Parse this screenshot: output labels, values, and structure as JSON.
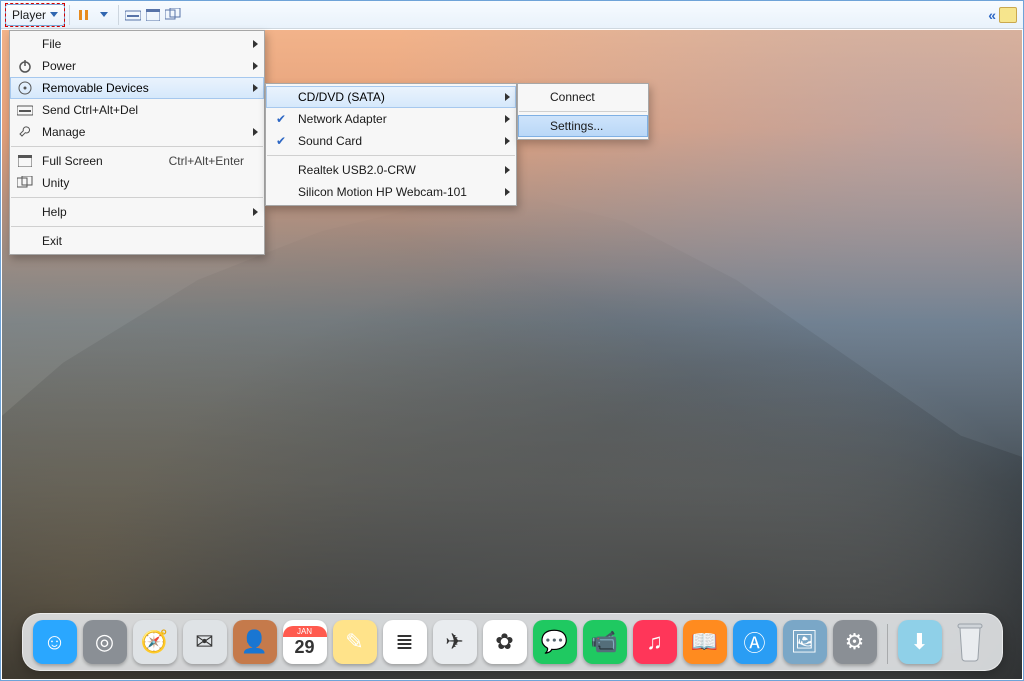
{
  "toolbar": {
    "player_label": "Player"
  },
  "menu1": {
    "file": {
      "label": "File"
    },
    "power": {
      "label": "Power"
    },
    "removable": {
      "label": "Removable Devices"
    },
    "send_cad": {
      "label": "Send Ctrl+Alt+Del"
    },
    "manage": {
      "label": "Manage"
    },
    "full_screen": {
      "label": "Full Screen",
      "accel": "Ctrl+Alt+Enter"
    },
    "unity": {
      "label": "Unity"
    },
    "help": {
      "label": "Help"
    },
    "exit": {
      "label": "Exit"
    }
  },
  "menu2": {
    "cd_dvd": {
      "label": "CD/DVD (SATA)"
    },
    "net_adapter": {
      "label": "Network Adapter"
    },
    "sound_card": {
      "label": "Sound Card"
    },
    "realtek": {
      "label": "Realtek USB2.0-CRW"
    },
    "webcam": {
      "label": "Silicon Motion HP Webcam-101"
    }
  },
  "menu3": {
    "connect": {
      "label": "Connect"
    },
    "settings": {
      "label": "Settings..."
    }
  },
  "dock": {
    "apps": [
      {
        "name": "finder",
        "bg": "#2aa7ff",
        "glyph": "☺"
      },
      {
        "name": "launchpad",
        "bg": "#8a8f95",
        "glyph": "◎"
      },
      {
        "name": "safari",
        "bg": "#dfe3e6",
        "glyph": "🧭"
      },
      {
        "name": "mail",
        "bg": "#dfe3e6",
        "glyph": "✉"
      },
      {
        "name": "contacts",
        "bg": "#c57a4b",
        "glyph": "👤"
      },
      {
        "name": "calendar",
        "bg": "#ffffff",
        "glyph": "29"
      },
      {
        "name": "notes",
        "bg": "#ffe38a",
        "glyph": "✎"
      },
      {
        "name": "reminders",
        "bg": "#ffffff",
        "glyph": "≣"
      },
      {
        "name": "maps",
        "bg": "#e9ecef",
        "glyph": "✈"
      },
      {
        "name": "photos",
        "bg": "#ffffff",
        "glyph": "✿"
      },
      {
        "name": "messages",
        "bg": "#1fc961",
        "glyph": "💬"
      },
      {
        "name": "facetime",
        "bg": "#1fc961",
        "glyph": "📹"
      },
      {
        "name": "itunes",
        "bg": "#ff3659",
        "glyph": "♫"
      },
      {
        "name": "ibooks",
        "bg": "#ff8b1f",
        "glyph": "📖"
      },
      {
        "name": "appstore",
        "bg": "#2a9df4",
        "glyph": "Ⓐ"
      },
      {
        "name": "preview",
        "bg": "#7aa7c7",
        "glyph": "🖼"
      },
      {
        "name": "sysprefs",
        "bg": "#8a8f95",
        "glyph": "⚙"
      }
    ],
    "downloads_name": "downloads",
    "trash_name": "trash"
  }
}
